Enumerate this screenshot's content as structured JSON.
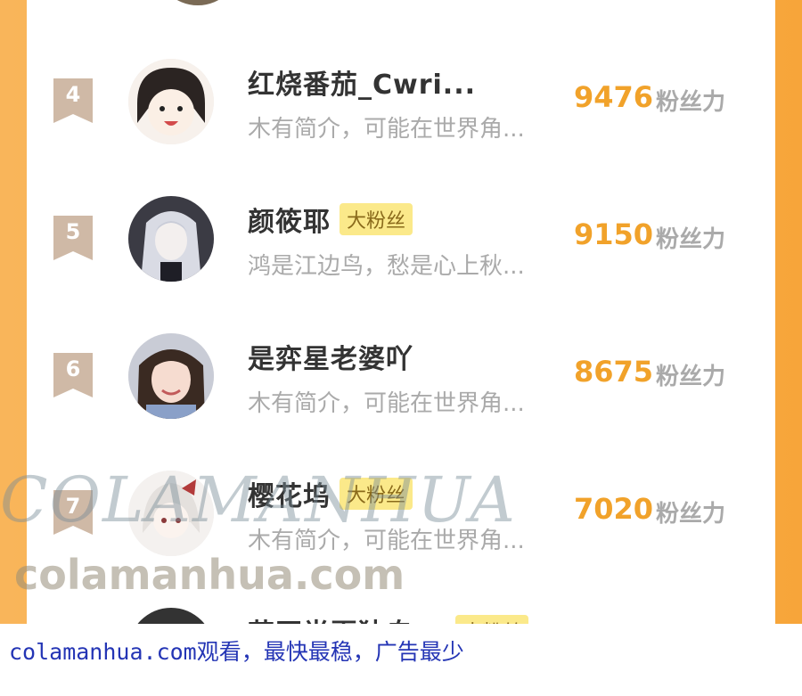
{
  "ranking": [
    {
      "rank": "4",
      "name": "红烧番茄_Cwri...",
      "badge": "",
      "intro": "木有简介，可能在世界角...",
      "score": "9476",
      "unit": "粉丝力"
    },
    {
      "rank": "5",
      "name": "颜筱耶",
      "badge": "大粉丝",
      "intro": "鸿是江边鸟，愁是心上秋...",
      "score": "9150",
      "unit": "粉丝力"
    },
    {
      "rank": "6",
      "name": "是弈星老婆吖",
      "badge": "",
      "intro": "木有简介，可能在世界角...",
      "score": "8675",
      "unit": "粉丝力"
    },
    {
      "rank": "7",
      "name": "樱花坞",
      "badge": "大粉丝",
      "intro": "木有简介，可能在世界角...",
      "score": "7020",
      "unit": "粉丝力"
    },
    {
      "rank": "",
      "name": "花开半夏独自...",
      "badge": "大粉丝",
      "intro": "",
      "score": "",
      "unit": ""
    }
  ],
  "watermark": {
    "line1": "COLAMANHUA",
    "line2": "colamanhua.com"
  },
  "footer_text": "colamanhua.com观看，最快最稳，广告最少",
  "colors": {
    "score": "#f1a22a",
    "badge_bg": "#fbe98a",
    "rank_tag": "#cfb9a6",
    "frame": "#f9b55a",
    "footer": "#2435b5"
  }
}
